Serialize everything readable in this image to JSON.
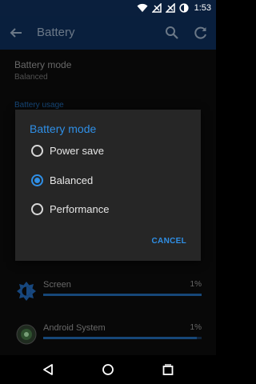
{
  "status_bar": {
    "time": "1:53"
  },
  "app_bar": {
    "title": "Battery"
  },
  "battery_mode_pref": {
    "title": "Battery mode",
    "value": "Balanced"
  },
  "usage": {
    "header": "Battery usage",
    "items": [
      {
        "name": "Screen",
        "percent": "1%",
        "fill": 1.0
      },
      {
        "name": "Android System",
        "percent": "1%",
        "fill": 0.97
      }
    ]
  },
  "dialog": {
    "title": "Battery mode",
    "options": [
      {
        "label": "Power save",
        "selected": false
      },
      {
        "label": "Balanced",
        "selected": true
      },
      {
        "label": "Performance",
        "selected": false
      }
    ],
    "cancel_label": "CANCEL"
  },
  "colors": {
    "accent": "#2f8fe6",
    "app_bar": "#0d2a52",
    "status_bar": "#0a1f3d",
    "dialog_bg": "#262626"
  },
  "icons": [
    "wifi-icon",
    "signal-off-icon",
    "signal-off-icon",
    "battery-icon",
    "back-arrow-icon",
    "search-icon",
    "refresh-icon",
    "screen-brightness-icon",
    "android-system-icon",
    "nav-back-icon",
    "nav-home-icon",
    "nav-recents-icon"
  ]
}
